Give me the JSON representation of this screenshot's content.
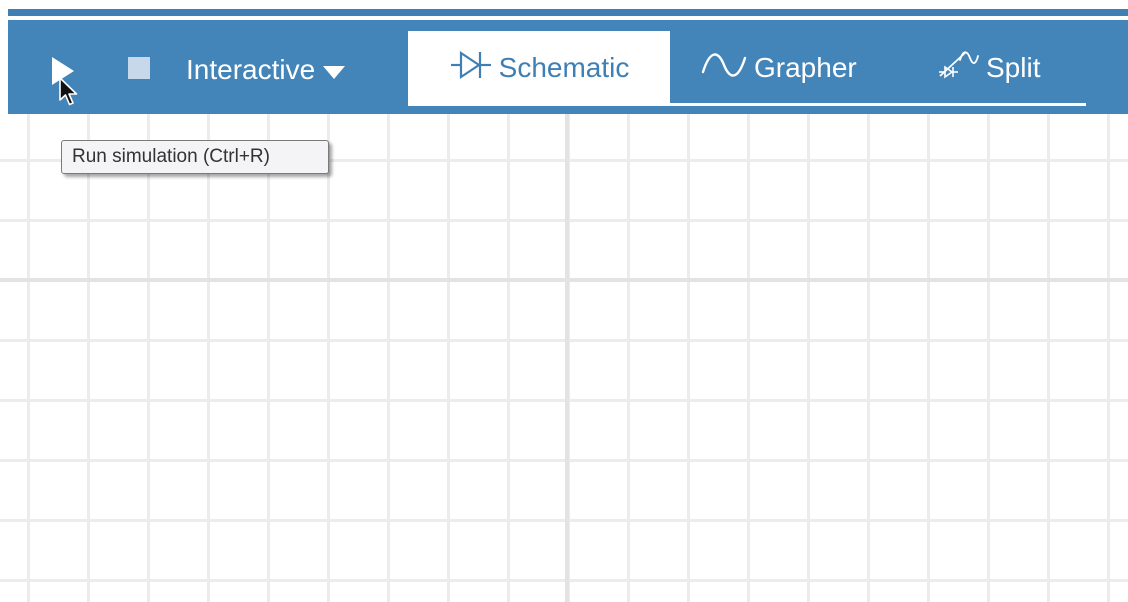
{
  "toolbar": {
    "run_icon": "play-icon",
    "stop_icon": "stop-icon",
    "mode_label": "Interactive",
    "mode_icon": "caret-down-icon",
    "tabs": [
      {
        "label": "Schematic",
        "icon": "diode-icon",
        "active": true
      },
      {
        "label": "Grapher",
        "icon": "sine-wave-icon",
        "active": false
      },
      {
        "label": "Split",
        "icon": "split-view-icon",
        "active": false
      }
    ]
  },
  "tooltip": {
    "text": "Run simulation (Ctrl+R)"
  },
  "colors": {
    "toolbar_bg": "#4384b9",
    "accent": "#3f7fb4",
    "grid_line": "#ececec",
    "stop_square": "#c6d8e9"
  }
}
